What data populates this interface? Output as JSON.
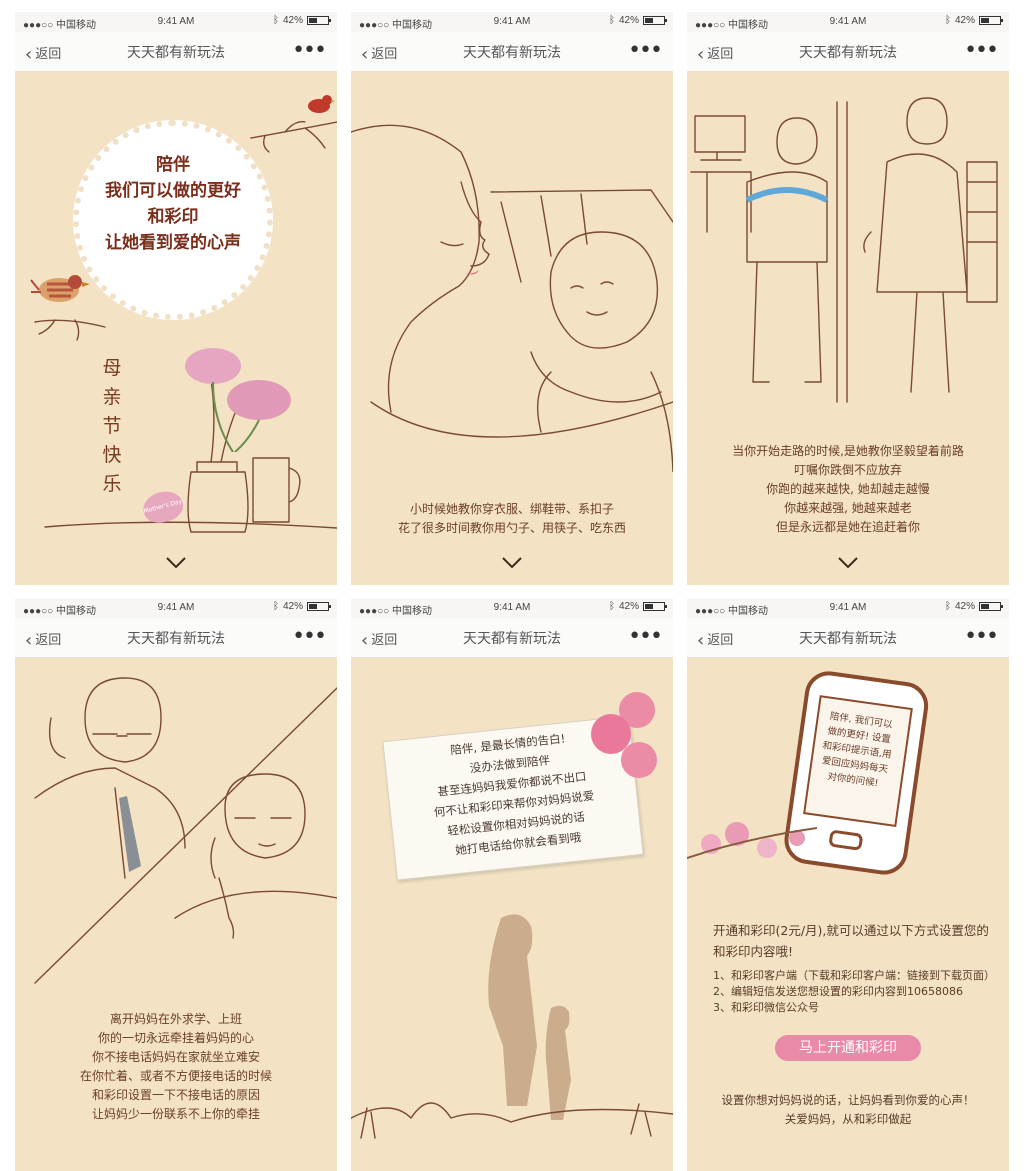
{
  "statusbar": {
    "carrier": "●●●○○ 中国移动",
    "time": "9:41 AM",
    "battery": "42%"
  },
  "navbar": {
    "back_label": "返回",
    "title": "天天都有新玩法",
    "more_label": "•••"
  },
  "screen1": {
    "badge_lines": [
      "陪伴",
      "我们可以做的更好",
      "和彩印",
      "让她看到爱的心声"
    ],
    "vertical_chars": [
      "母",
      "亲",
      "节",
      "快",
      "乐"
    ],
    "tag_text": "Mother's Day"
  },
  "screen2": {
    "caption": [
      "小时候她教你穿衣服、绑鞋带、系扣子",
      "花了很多时间教你用勺子、用筷子、吃东西"
    ]
  },
  "screen3": {
    "caption": [
      "当你开始走路的时候,是她教你坚毅望着前路",
      "叮嘱你跌倒不应放弃",
      "你跑的越来越快, 她却越走越慢",
      "你越来越强, 她越来越老",
      "但是永远都是她在追赶着你"
    ]
  },
  "screen4": {
    "caption": [
      "离开妈妈在外求学、上班",
      "你的一切永远牵挂着妈妈的心",
      "你不接电话妈妈在家就坐立难安",
      "在你忙着、或者不方便接电话的时候",
      "和彩印设置一下不接电话的原因",
      "让妈妈少一份联系不上你的牵挂"
    ]
  },
  "screen5": {
    "note": [
      "陪伴, 是最长情的告白!",
      "没办法做到陪伴",
      "甚至连妈妈我爱你都说不出口",
      "何不让和彩印来帮你对妈妈说爱",
      "轻松设置你相对妈妈说的话",
      "她打电话给你就会看到哦"
    ]
  },
  "screen6": {
    "phone_text": [
      "陪伴, 我们可以",
      "做的更好! 设置",
      "和彩印提示语,用",
      "爱回应妈妈每天",
      "对你的问候!"
    ],
    "intro": "开通和彩印(2元/月),就可以通过以下方式设置您的和彩印内容哦!",
    "steps": [
      "1、和彩印客户端（下载和彩印客户端：链接到下载页面）",
      "2、编辑短信发送您想设置的彩印内容到10658086",
      "3、和彩印微信公众号"
    ],
    "cta_label": "马上开通和彩印",
    "footer": [
      "设置你想对妈妈说的话，让妈妈看到你爱的心声！",
      "关爱妈妈，从和彩印做起"
    ]
  }
}
